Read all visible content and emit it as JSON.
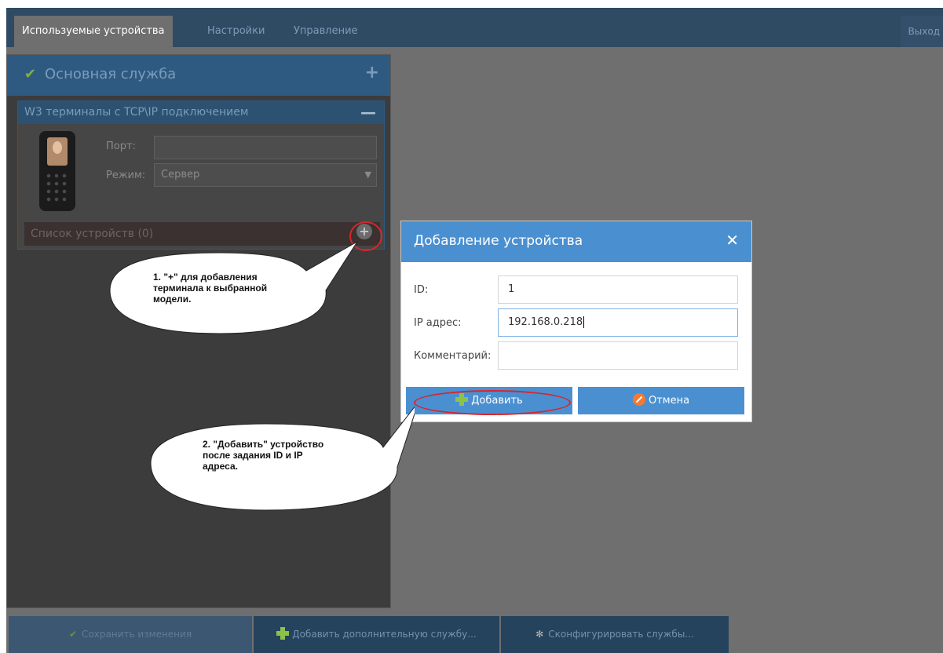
{
  "topbar": {
    "tabs": [
      {
        "label": "Используемые устройства"
      },
      {
        "label": "Настройки"
      },
      {
        "label": "Управление"
      }
    ],
    "logout_label": "Выход"
  },
  "panel": {
    "title": "Основная служба",
    "subpanel": {
      "title": "W3 терминалы с TCP\\IP подключением",
      "port_label": "Порт:",
      "port_value": "",
      "mode_label": "Режим:",
      "mode_value": "Сервер",
      "device_list_label": "Список устройств (0)"
    }
  },
  "bottom": {
    "save_label": "Сохранить изменения",
    "add_service_label": "Добавить дополнительную службу...",
    "configure_label": "Сконфигурировать службы..."
  },
  "dialog": {
    "title": "Добавление устройства",
    "id_label": "ID:",
    "id_value": "1",
    "ip_label": "IP адрес:",
    "ip_value": "192.168.0.218",
    "comment_label": "Комментарий:",
    "comment_value": "",
    "add_label": "Добавить",
    "cancel_label": "Отмена"
  },
  "annotations": {
    "note1": [
      "1. \"+\" для добавления",
      "терминала к выбранной",
      "модели."
    ],
    "note2": [
      "2. \"Добавить\" устройство",
      "после задания ID и IP",
      "адреса."
    ]
  },
  "colors": {
    "accent": "#4a90d1",
    "header": "#2f4a63",
    "highlight": "#d7262d"
  }
}
